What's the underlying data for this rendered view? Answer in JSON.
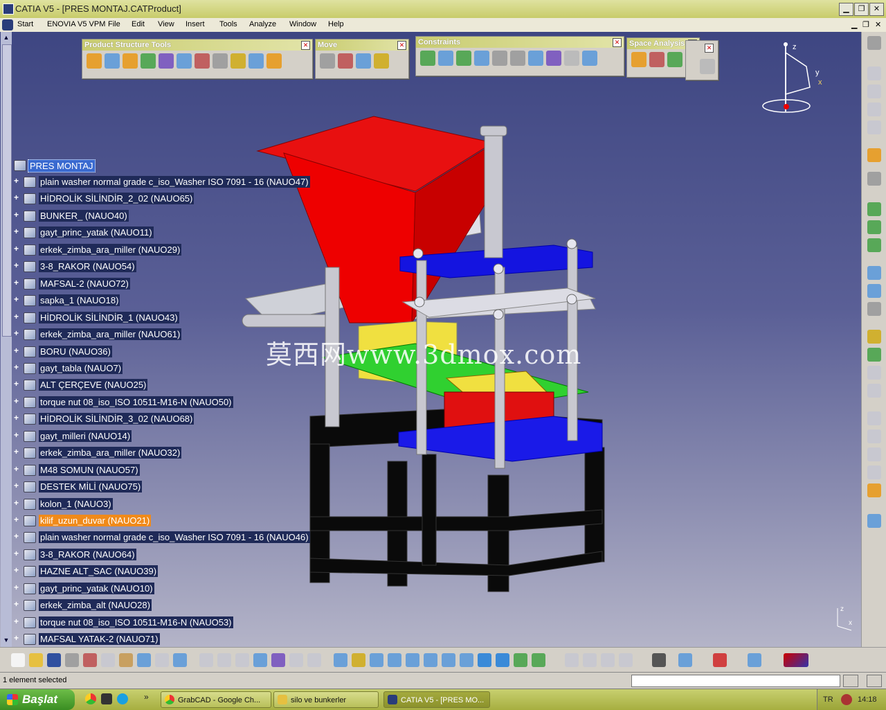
{
  "window": {
    "title": "CATIA V5 - [PRES MONTAJ.CATProduct]",
    "buttons": {
      "minimize": "▁",
      "restore": "❐",
      "close": "✕"
    }
  },
  "menu": {
    "items": [
      "Start",
      "ENOVIA V5 VPM",
      "File",
      "Edit",
      "View",
      "Insert",
      "Tools",
      "Analyze",
      "Window",
      "Help"
    ]
  },
  "toolbars": {
    "product_structure": "Product Structure Tools",
    "move": "Move",
    "constraints": "Constraints",
    "space_analysis": "Space Analysis",
    "close_glyph": "✕"
  },
  "tree": {
    "root": "PRES MONTAJ",
    "items": [
      "plain washer normal grade c_iso_Washer ISO 7091 - 16 (NAUO47)",
      "HİDROLİK SİLİNDİR_2_02 (NAUO65)",
      "BUNKER_ (NAUO40)",
      "gayt_princ_yatak (NAUO11)",
      "erkek_zimba_ara_miller (NAUO29)",
      "3-8_RAKOR (NAUO54)",
      "MAFSAL-2 (NAUO72)",
      "sapka_1 (NAUO18)",
      "HİDROLİK SİLİNDİR_1 (NAUO43)",
      "erkek_zimba_ara_miller (NAUO61)",
      "BORU (NAUO36)",
      "gayt_tabla (NAUO7)",
      "ALT ÇERÇEVE (NAUO25)",
      "torque nut 08_iso_ISO 10511-M16-N (NAUO50)",
      "HİDROLİK SİLİNDİR_3_02 (NAUO68)",
      "gayt_milleri (NAUO14)",
      "erkek_zimba_ara_miller (NAUO32)",
      "M48 SOMUN (NAUO57)",
      "DESTEK MİLİ (NAUO75)",
      "kolon_1 (NAUO3)",
      "kilif_uzun_duvar (NAUO21)",
      "plain washer normal grade c_iso_Washer ISO 7091 - 16 (NAUO46)",
      "3-8_RAKOR (NAUO64)",
      "HAZNE ALT_SAC (NAUO39)",
      "gayt_princ_yatak (NAUO10)",
      "erkek_zimba_alt (NAUO28)",
      "torque nut 08_iso_ISO 10511-M16-N (NAUO53)",
      "MAFSAL YATAK-2 (NAUO71)"
    ],
    "highlighted_index": 20
  },
  "compass": {
    "z": "z",
    "y": "y",
    "x": "x"
  },
  "axis_triad": {
    "z": "z",
    "x": "x"
  },
  "watermark": "莫西网www.3dmox.com",
  "status": {
    "text": "1 element selected"
  },
  "taskbar": {
    "start": "Başlat",
    "tasks": [
      "GrabCAD - Google Ch...",
      "silo ve bunkerler",
      "CATIA V5 - [PRES MO..."
    ],
    "lang": "TR",
    "clock": "14:18",
    "overflow": "»"
  },
  "colors": {
    "viewport_top": "#3e4682",
    "highlight": "#f08a1a",
    "tree_label_bg": "#1f2a58"
  }
}
